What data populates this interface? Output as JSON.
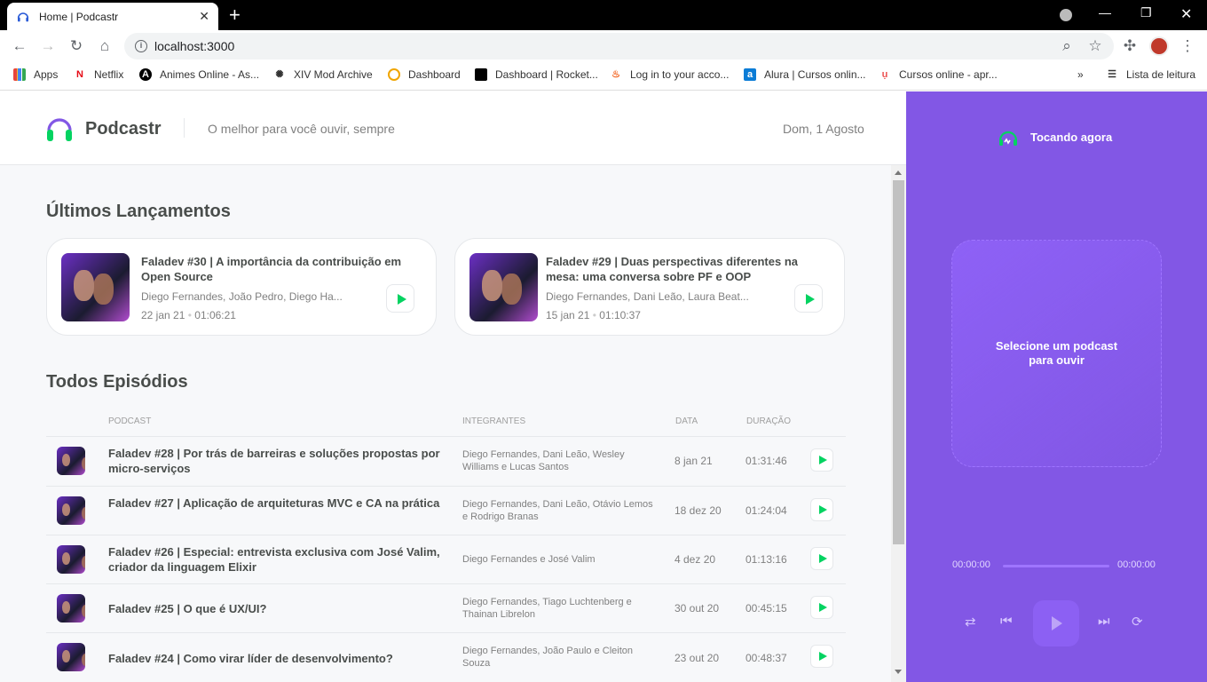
{
  "browser": {
    "tab_title": "Home | Podcastr",
    "url": "localhost:3000",
    "bookmarks": [
      "Apps",
      "Netflix",
      "Animes Online - As...",
      "XIV Mod Archive",
      "Dashboard",
      "Dashboard | Rocket...",
      "Log in to your acco...",
      "Alura | Cursos onlin...",
      "Cursos online - apr..."
    ],
    "reading_list": "Lista de leitura"
  },
  "header": {
    "brand": "Podcastr",
    "tagline": "O melhor para você ouvir, sempre",
    "date": "Dom, 1 Agosto"
  },
  "latest": {
    "title": "Últimos Lançamentos",
    "episodes": [
      {
        "title": "Faladev #30 | A importância da contribuição em Open Source",
        "members": "Diego Fernandes, João Pedro, Diego Ha...",
        "date": "22 jan 21",
        "duration": "01:06:21"
      },
      {
        "title": "Faladev #29 | Duas perspectivas diferentes na mesa: uma conversa sobre PF e OOP",
        "members": "Diego Fernandes, Dani Leão, Laura Beat...",
        "date": "15 jan 21",
        "duration": "01:10:37"
      }
    ]
  },
  "all": {
    "title": "Todos Episódios",
    "columns": {
      "podcast": "Podcast",
      "members": "Integrantes",
      "date": "Data",
      "duration": "Duração"
    },
    "episodes": [
      {
        "title": "Faladev #28 | Por trás de barreiras e soluções propostas por micro-serviços",
        "members": "Diego Fernandes, Dani Leão, Wesley Williams e Lucas Santos",
        "date": "8 jan 21",
        "duration": "01:31:46"
      },
      {
        "title": "Faladev #27 | Aplicação de arquiteturas MVC e CA na prática",
        "members": "Diego Fernandes, Dani Leão, Otávio Lemos e Rodrigo Branas",
        "date": "18 dez 20",
        "duration": "01:24:04"
      },
      {
        "title": "Faladev #26 | Especial: entrevista exclusiva com José Valim, criador da linguagem Elixir",
        "members": "Diego Fernandes e José Valim",
        "date": "4 dez 20",
        "duration": "01:13:16"
      },
      {
        "title": "Faladev #25 | O que é UX/UI?",
        "members": "Diego Fernandes, Tiago Luchtenberg e Thainan Librelon",
        "date": "30 out 20",
        "duration": "00:45:15"
      },
      {
        "title": "Faladev #24 | Como virar líder de desenvolvimento?",
        "members": "Diego Fernandes, João Paulo e Cleiton Souza",
        "date": "23 out 20",
        "duration": "00:48:37"
      }
    ]
  },
  "player": {
    "title": "Tocando agora",
    "empty_text": "Selecione um podcast para ouvir",
    "time_start": "00:00:00",
    "time_end": "00:00:00"
  },
  "colors": {
    "purple": "#8257e5",
    "green": "#04d361",
    "text": "#494d4b"
  }
}
